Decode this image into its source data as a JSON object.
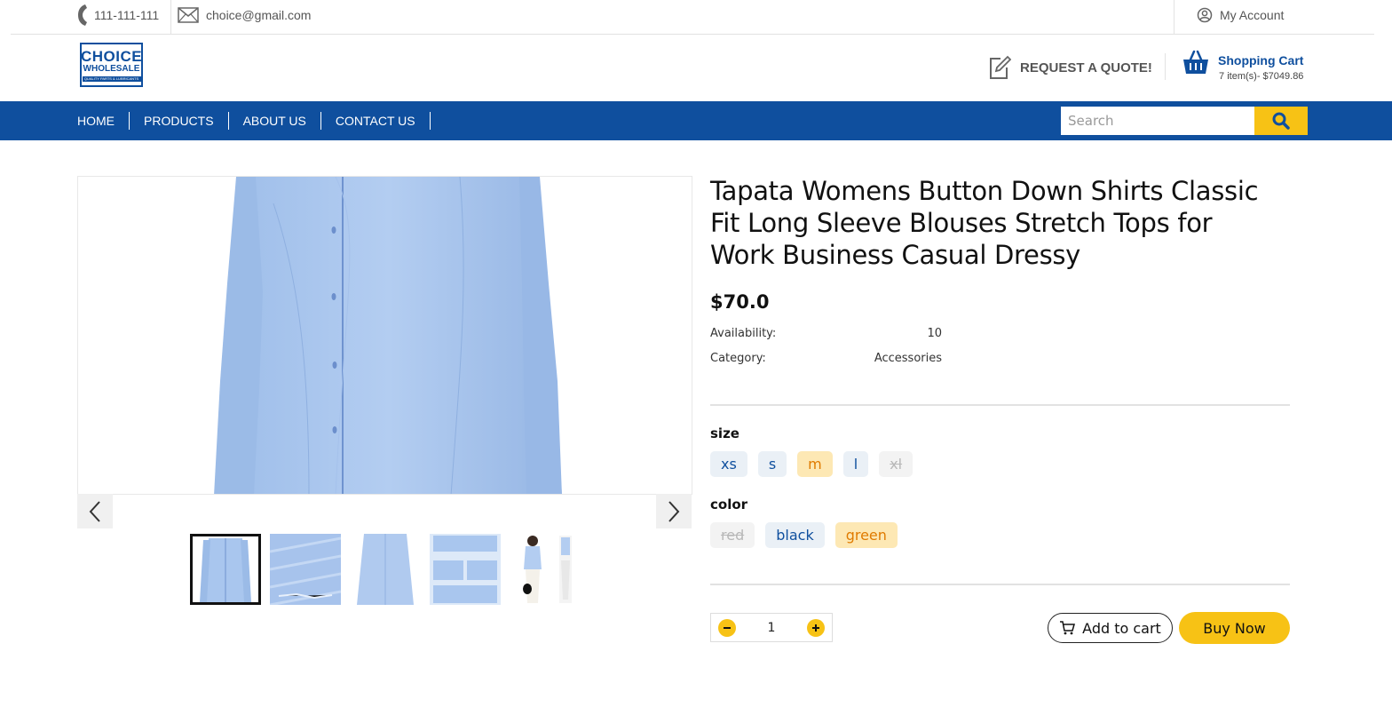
{
  "topbar": {
    "phone": "111-111-111",
    "email": "choice@gmail.com",
    "account_label": "My Account"
  },
  "header": {
    "logo_line1": "CHOICE",
    "logo_line2": "WHOLESALE",
    "logo_line3": "QUALITY PARTS & LUBRICANTS",
    "quote_label": "REQUEST A QUOTE!",
    "cart_title": "Shopping Cart",
    "cart_summary": "7 item(s)- $7049.86"
  },
  "nav": {
    "items": [
      "HOME",
      "PRODUCTS",
      "ABOUT US",
      "CONTACT US"
    ],
    "search_placeholder": "Search"
  },
  "product": {
    "title": "Tapata Womens Button Down Shirts Classic Fit Long Sleeve Blouses Stretch Tops for Work Business Casual Dressy",
    "price": "$70.0",
    "availability_label": "Availability:",
    "availability_value": "10",
    "category_label": "Category:",
    "category_value": "Accessories",
    "size_label": "size",
    "sizes": [
      {
        "label": "xs",
        "state": "normal"
      },
      {
        "label": "s",
        "state": "normal"
      },
      {
        "label": "m",
        "state": "selected"
      },
      {
        "label": "l",
        "state": "normal"
      },
      {
        "label": "xl",
        "state": "disabled"
      }
    ],
    "color_label": "color",
    "colors": [
      {
        "label": "red",
        "state": "disabled"
      },
      {
        "label": "black",
        "state": "normal"
      },
      {
        "label": "green",
        "state": "selected"
      }
    ],
    "quantity": "1",
    "add_to_cart_label": "Add to cart",
    "buy_now_label": "Buy Now",
    "thumbnail_count": 5,
    "active_thumbnail": 1
  },
  "colors": {
    "brand_blue": "#0f4f9e",
    "accent_yellow": "#f7c215",
    "selected_chip_bg": "#fde8b4",
    "selected_chip_text": "#e07b00",
    "shirt": "#a9c6ee"
  },
  "icons": {
    "phone": "phone-icon",
    "mail": "mail-icon",
    "account": "user-circle-icon",
    "quote": "edit-icon",
    "cart": "basket-icon",
    "search": "search-icon",
    "prev": "chevron-left-icon",
    "next": "chevron-right-icon",
    "minus": "minus-icon",
    "plus": "plus-icon",
    "add_cart": "cart-icon"
  }
}
